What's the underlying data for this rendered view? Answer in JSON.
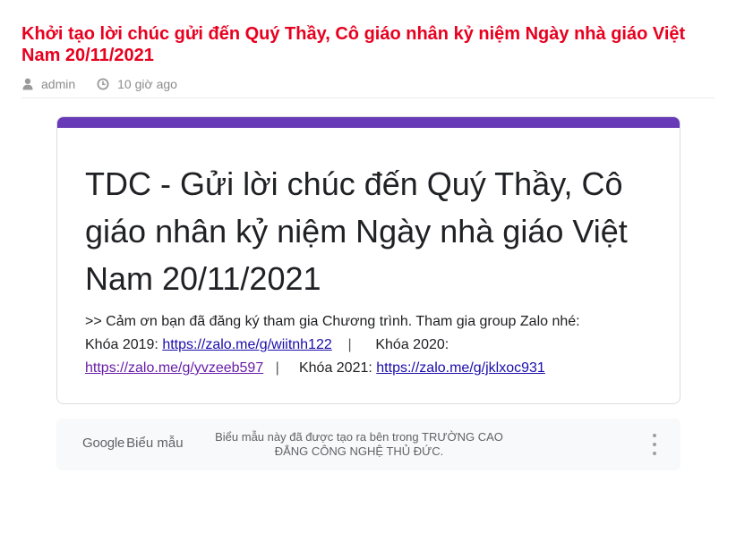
{
  "post": {
    "title": "Khởi tạo lời chúc gửi đến Quý Thầy, Cô giáo nhân kỷ niệm Ngày nhà giáo Việt Nam 20/11/2021",
    "author": "admin",
    "time": "10 giờ ago",
    "icons": {
      "author": "user-icon",
      "time": "clock-icon"
    }
  },
  "form": {
    "accent_color": "#673ab7",
    "title": "TDC - Gửi lời chúc đến Quý Thầy, Cô giáo nhân kỷ niệm Ngày nhà giáo Việt Nam 20/11/2021",
    "intro": ">> Cảm ơn bạn đã đăng ký tham gia Chương trình. Tham gia group Zalo nhé:",
    "k2019_label": "Khóa 2019:",
    "k2019_link": "https://zalo.me/g/wiitnh122",
    "separator": "|",
    "k2020_label": "Khóa 2020:",
    "k2020_link": "https://zalo.me/g/yvzeeb597",
    "k2021_label": "Khóa 2021:",
    "k2021_link": "https://zalo.me/g/jklxoc931"
  },
  "footer": {
    "google": "Google",
    "forms": "Biểu mẫu",
    "note": "Biểu mẫu này đã được tạo ra bên trong TRƯỜNG CAO ĐẲNG CÔNG NGHỆ THỦ ĐỨC.",
    "more_icon": "more-vertical-icon"
  },
  "colors": {
    "title_red": "#e8001f",
    "link": "#1a0dab",
    "visited_link": "#681da8"
  }
}
